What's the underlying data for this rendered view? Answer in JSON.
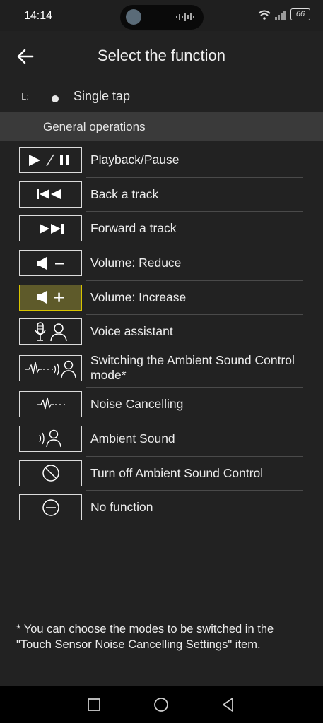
{
  "status_bar": {
    "time": "14:14",
    "battery": "66"
  },
  "header": {
    "title": "Select the function"
  },
  "side": {
    "label": "L:",
    "value": "Single tap"
  },
  "section": {
    "title": "General operations"
  },
  "items": [
    {
      "label": "Playback/Pause",
      "icon": "play-pause-icon"
    },
    {
      "label": "Back a track",
      "icon": "previous-track-icon"
    },
    {
      "label": "Forward a track",
      "icon": "next-track-icon"
    },
    {
      "label": "Volume: Reduce",
      "icon": "volume-down-icon"
    },
    {
      "label": "Volume: Increase",
      "icon": "volume-up-icon",
      "selected": true
    },
    {
      "label": "Voice assistant",
      "icon": "voice-assistant-icon"
    },
    {
      "label": "Switching the Ambient Sound Control mode*",
      "icon": "ambient-switch-icon"
    },
    {
      "label": "Noise Cancelling",
      "icon": "noise-cancelling-icon"
    },
    {
      "label": "Ambient Sound",
      "icon": "ambient-sound-icon"
    },
    {
      "label": "Turn off Ambient Sound Control",
      "icon": "off-icon"
    },
    {
      "label": "No function",
      "icon": "no-function-icon"
    }
  ],
  "footnote": "* You can choose the modes to be switched in the \"Touch Sensor Noise Cancelling Settings\" item.",
  "colors": {
    "background": "#222222",
    "section_header": "#3a3a3a",
    "selected_fill": "#5e5a2a",
    "selected_border": "#d8c400"
  }
}
